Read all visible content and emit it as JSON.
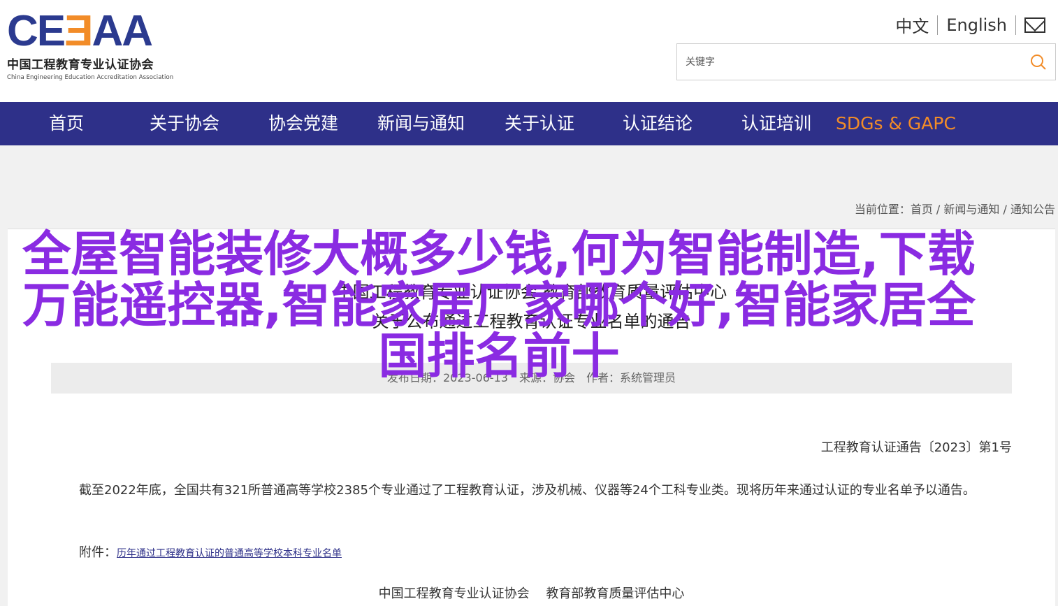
{
  "logo": {
    "mark_pre": "CE",
    "mark_e": "Ǝ",
    "mark_post": "AA",
    "cn_name": "中国工程教育专业认证协会",
    "en_name": "China Engineering Education Accreditation Association"
  },
  "lang": {
    "zh": "中文",
    "en": "English"
  },
  "search": {
    "placeholder": "关键字"
  },
  "nav": {
    "items": [
      "首页",
      "关于协会",
      "协会党建",
      "新闻与通知",
      "关于认证",
      "认证结论",
      "认证培训",
      "SDGs & GAPC"
    ]
  },
  "breadcrumb": {
    "prefix": "当前位置：",
    "items": [
      "首页",
      "新闻与通知",
      "通知公告"
    ],
    "sep": " / "
  },
  "article": {
    "title_line1": "中国工程教育专业认证协会 教育部教育质量评估中心",
    "title_line2": "关于公布通过工程教育认证专业名单的通告",
    "meta": "发布日期：2023-06-13　来源：协会　作者：系统管理员",
    "notice_no": "工程教育认证通告〔2023〕第1号",
    "paragraph": "截至2022年底，全国共有321所普通高等学校2385个专业通过了工程教育认证，涉及机械、仪器等24个工科专业类。现将历年来通过认证的专业名单予以通告。",
    "attach_label": "附件：",
    "attach_link": "历年通过工程教育认证的普通高等学校本科专业名单",
    "signature": "中国工程教育专业认证协会　 教育部教育质量评估中心"
  },
  "overlay_title": "全屋智能装修大概多少钱,何为智能制造,下载万能遥控器,智能家居厂家哪个好,智能家居全国排名前十",
  "colors": {
    "nav_bg": "#2e3089",
    "accent": "#f28c28",
    "overlay": "#8a2be2"
  }
}
